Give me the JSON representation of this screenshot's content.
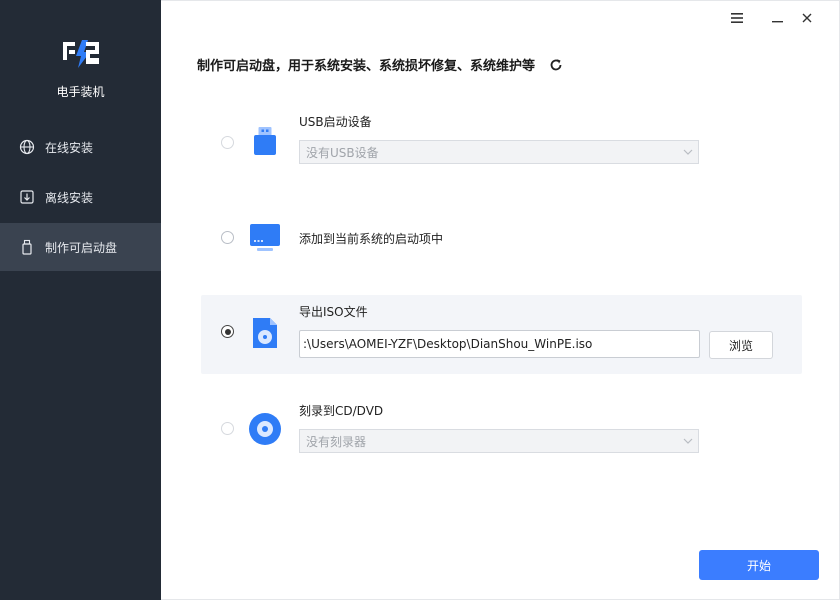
{
  "app": {
    "name": "电手装机"
  },
  "sidebar": {
    "items": [
      {
        "label": "在线安装",
        "icon": "globe-icon"
      },
      {
        "label": "离线安装",
        "icon": "download-icon"
      },
      {
        "label": "制作可启动盘",
        "icon": "usb-drive-icon",
        "active": true
      }
    ]
  },
  "main": {
    "headline": "制作可启动盘，用于系统安装、系统损坏修复、系统维护等",
    "options": [
      {
        "title": "USB启动设备",
        "select_value": "没有USB设备",
        "enabled": false
      },
      {
        "title": "添加到当前系统的启动项中",
        "enabled": true
      },
      {
        "title": "导出ISO文件",
        "path_value": ":\\Users\\AOMEI-YZF\\Desktop\\DianShou_WinPE.iso",
        "browse_label": "浏览",
        "selected": true
      },
      {
        "title": "刻录到CD/DVD",
        "select_value": "没有刻录器",
        "enabled": false
      }
    ],
    "start_label": "开始"
  },
  "colors": {
    "accent": "#3b7dff",
    "sidebar_bg": "#232b36",
    "sidebar_active": "#3a4350",
    "icon_blue": "#2f7cf6"
  }
}
